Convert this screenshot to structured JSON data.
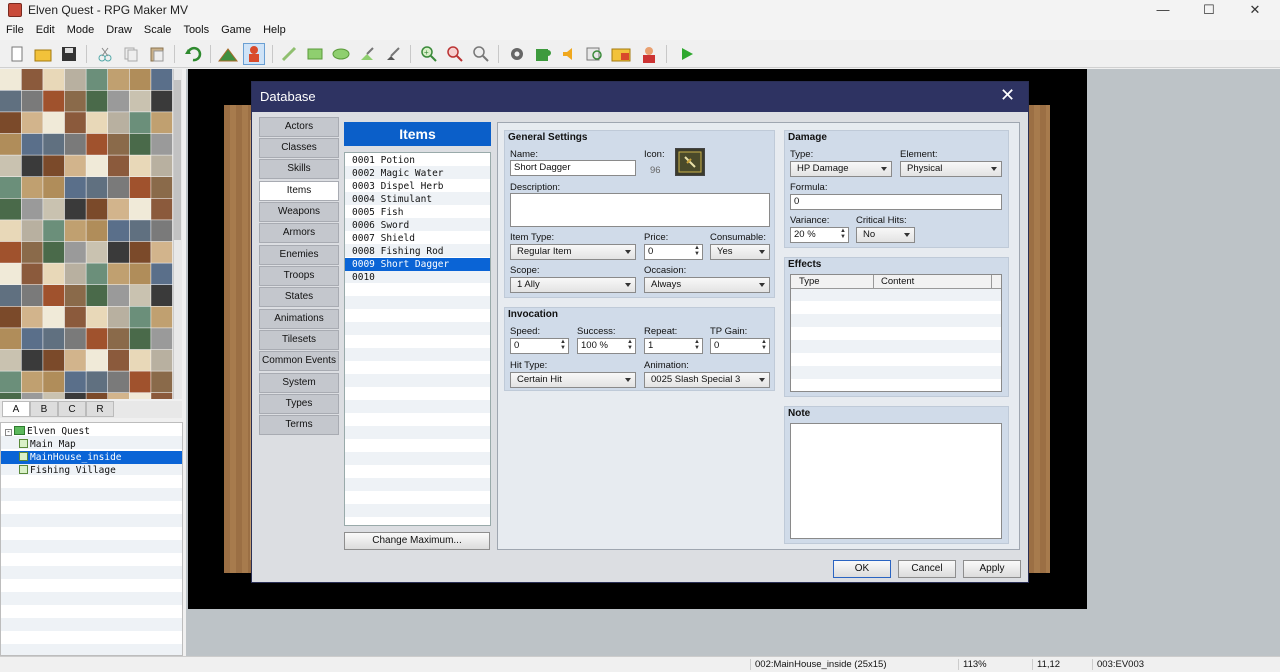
{
  "window": {
    "title": "Elven Quest - RPG Maker MV",
    "min": "—",
    "max": "☐",
    "close": "✕"
  },
  "menubar": [
    "File",
    "Edit",
    "Mode",
    "Draw",
    "Scale",
    "Tools",
    "Game",
    "Help"
  ],
  "toolbar": {
    "icons": [
      "new-project-icon",
      "open-project-icon",
      "save-project-icon",
      "cut-icon",
      "copy-icon",
      "paste-icon",
      "undo-icon",
      "map-mode-icon",
      "event-mode-icon",
      "pencil-icon",
      "rectangle-icon",
      "ellipse-icon",
      "fill-icon",
      "shadow-pen-icon",
      "zoom-in-icon",
      "zoom-out-icon",
      "actual-size-icon",
      "database-icon",
      "plugin-manager-icon",
      "sound-test-icon",
      "event-searcher-icon",
      "resource-manager-icon",
      "character-generator-icon",
      "playtest-icon"
    ]
  },
  "tile_tabs": [
    "A",
    "B",
    "C",
    "R"
  ],
  "map_tree": [
    {
      "label": "Elven Quest",
      "level": 0,
      "selected": false
    },
    {
      "label": "Main Map",
      "level": 1,
      "selected": false
    },
    {
      "label": "MainHouse_inside",
      "level": 1,
      "selected": true
    },
    {
      "label": "Fishing Village",
      "level": 1,
      "selected": false
    }
  ],
  "statusbar": {
    "map": "002:MainHouse_inside (25x15)",
    "zoom": "113%",
    "coords": "11,12",
    "event": "003:EV003"
  },
  "dialog": {
    "title": "Database",
    "close": "✕",
    "categories": [
      "Actors",
      "Classes",
      "Skills",
      "Items",
      "Weapons",
      "Armors",
      "Enemies",
      "Troops",
      "States",
      "Animations",
      "Tilesets",
      "Common Events",
      "System",
      "Types",
      "Terms"
    ],
    "active_category": "Items",
    "list_header": "Items",
    "items": [
      "0001 Potion",
      "0002 Magic Water",
      "0003 Dispel Herb",
      "0004 Stimulant",
      "0005 Fish",
      "0006 Sword",
      "0007 Shield",
      "0008 Fishing Rod",
      "0009 Short Dagger",
      "0010"
    ],
    "selected_item": "0009 Short Dagger",
    "change_max": "Change Maximum...",
    "general": {
      "title": "General Settings",
      "name_label": "Name:",
      "name": "Short Dagger",
      "icon_label": "Icon:",
      "icon_index": "96",
      "desc_label": "Description:",
      "desc": "",
      "item_type_label": "Item Type:",
      "item_type": "Regular Item",
      "price_label": "Price:",
      "price": "0",
      "consumable_label": "Consumable:",
      "consumable": "Yes",
      "scope_label": "Scope:",
      "scope": "1 Ally",
      "occasion_label": "Occasion:",
      "occasion": "Always"
    },
    "invocation": {
      "title": "Invocation",
      "speed_label": "Speed:",
      "speed": "0",
      "success_label": "Success:",
      "success": "100 %",
      "repeat_label": "Repeat:",
      "repeat": "1",
      "tp_label": "TP Gain:",
      "tp": "0",
      "hit_label": "Hit Type:",
      "hit": "Certain Hit",
      "anim_label": "Animation:",
      "anim": "0025 Slash Special 3"
    },
    "damage": {
      "title": "Damage",
      "type_label": "Type:",
      "type": "HP Damage",
      "element_label": "Element:",
      "element": "Physical",
      "formula_label": "Formula:",
      "formula": "0",
      "variance_label": "Variance:",
      "variance": "20 %",
      "critical_label": "Critical Hits:",
      "critical": "No"
    },
    "effects": {
      "title": "Effects",
      "col_type": "Type",
      "col_content": "Content"
    },
    "note": {
      "title": "Note",
      "text": ""
    },
    "buttons": {
      "ok": "OK",
      "cancel": "Cancel",
      "apply": "Apply"
    }
  }
}
